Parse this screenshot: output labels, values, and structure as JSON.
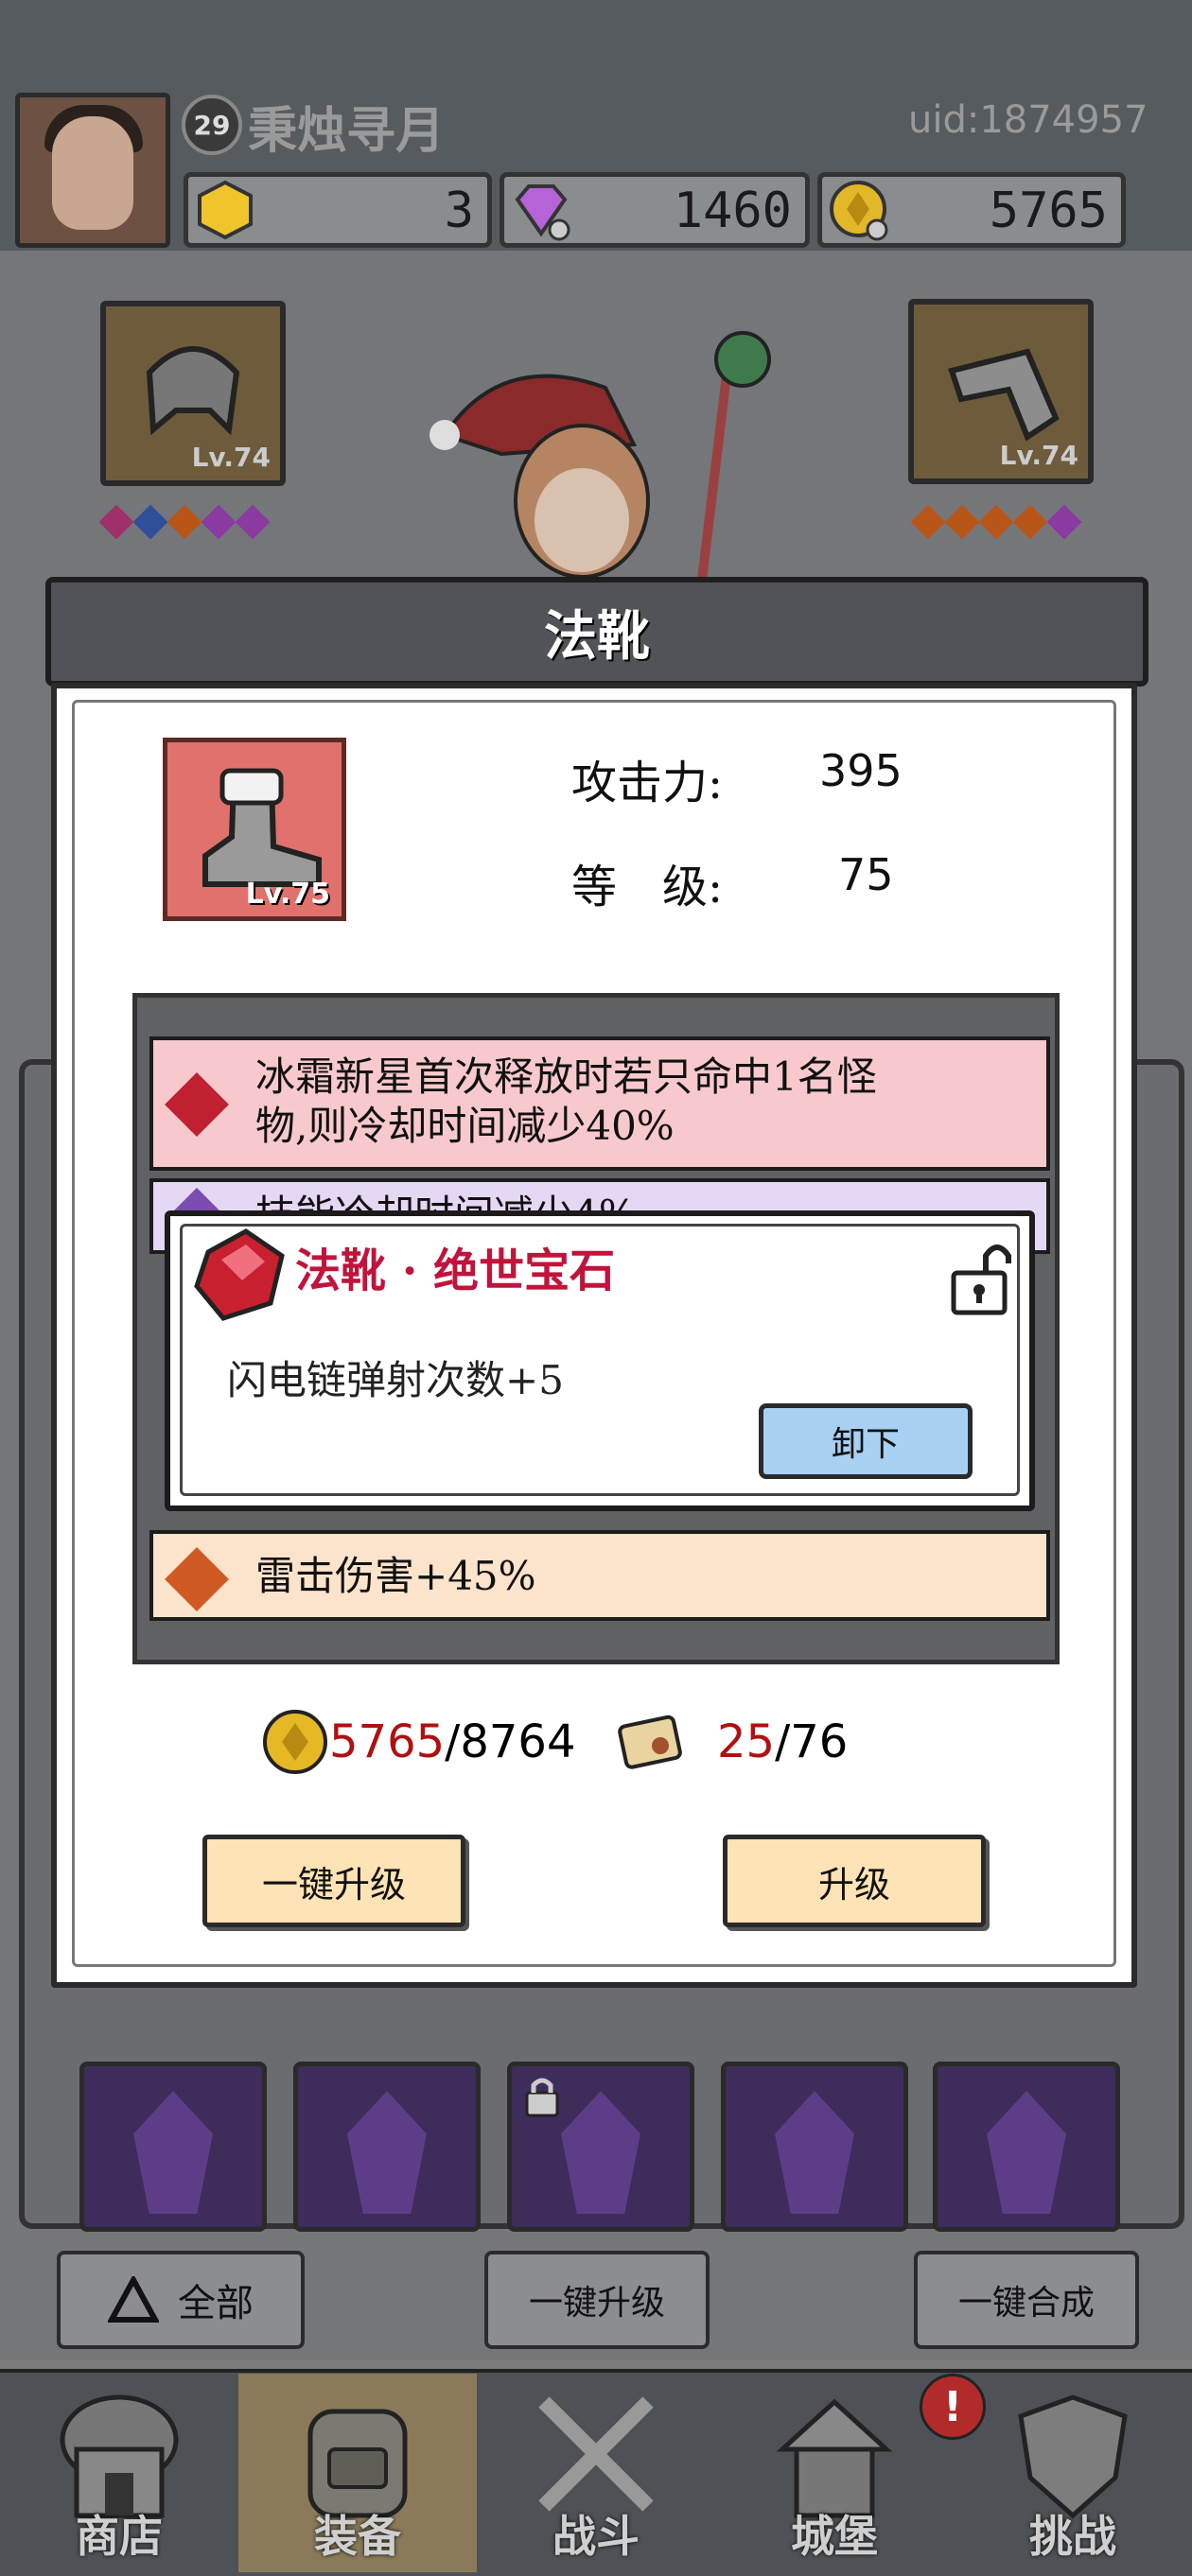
{
  "player": {
    "level": "29",
    "name": "秉烛寻月",
    "uid": "uid:1874957"
  },
  "currencies": [
    {
      "icon": "gold-gem-icon",
      "value": "3"
    },
    {
      "icon": "purple-diamond-icon",
      "value": "1460"
    },
    {
      "icon": "gold-coin-icon",
      "value": "5765"
    }
  ],
  "equipment_slots": [
    {
      "icon": "helmet-icon",
      "level": "Lv.74"
    },
    {
      "icon": "gauntlet-icon",
      "level": "Lv.74"
    }
  ],
  "modal": {
    "title": "法靴",
    "item_level": "Lv.75",
    "stats": [
      {
        "label": "攻击力:",
        "value": "395"
      },
      {
        "label": "等　级:",
        "value": "75"
      }
    ],
    "effects": [
      {
        "text_line1": "冰霜新星首次释放时若只命中1名怪",
        "text_line2": "物,则冷却时间减少40%",
        "color": "#f7c9cd",
        "gem_color": "#c02030"
      },
      {
        "text_line1": "技能冷却时间减少4%",
        "color": "#e4d8f4",
        "gem_color": "#7a4bb0"
      },
      {
        "text_line1": "雷击伤害+45%",
        "color": "#fbe3cc",
        "gem_color": "#d05a24"
      }
    ],
    "popup": {
      "title": "法靴 · 绝世宝石",
      "description": "闪电链弹射次数+5",
      "unequip_label": "卸下"
    },
    "costs": {
      "gold_have": "5765",
      "gold_need": "/8764",
      "scroll_have": "25",
      "scroll_need": "/76"
    },
    "buttons": {
      "one_click_upgrade": "一键升级",
      "upgrade": "升级"
    }
  },
  "inventory_filters": {
    "all": "全部",
    "one_click_upgrade": "一键升级",
    "one_click_merge": "一键合成"
  },
  "tabs": [
    {
      "label": "商店",
      "icon": "shop-icon"
    },
    {
      "label": "装备",
      "icon": "backpack-icon"
    },
    {
      "label": "战斗",
      "icon": "crossed-swords-icon"
    },
    {
      "label": "城堡",
      "icon": "castle-icon"
    },
    {
      "label": "挑战",
      "icon": "shield-icon"
    }
  ],
  "tab_alert": "!"
}
